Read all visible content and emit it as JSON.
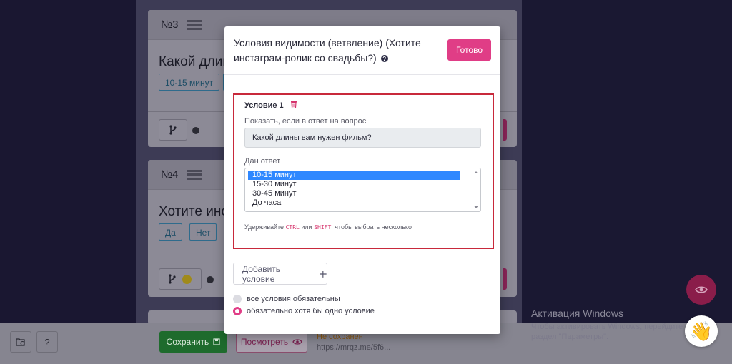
{
  "page": {
    "card3": {
      "number": "№3",
      "question": "Какой длин",
      "chips": [
        "10-15 минут"
      ]
    },
    "card4": {
      "number": "№4",
      "question": "Хотите инс",
      "chips": [
        "Да",
        "Нет"
      ]
    },
    "bottom": {
      "save_label": "Сохранить",
      "preview_label": "Посмотреть",
      "status": "Не сохранен",
      "short_url": "https://mrqz.me/5f6..."
    },
    "windows_activation": {
      "title": "Активация Windows",
      "line1": "Чтобы активировать Windows, перейдите",
      "line2": "раздел \"Параметры\"."
    }
  },
  "modal": {
    "title": "Условия видимости (ветвление) (Хотите инстаграм-ролик со свадьбы?)",
    "done_label": "Готово",
    "condition": {
      "title": "Условие 1",
      "show_if_label": "Показать, если в ответ на вопрос",
      "question_value": "Какой длины вам нужен фильм?",
      "answer_label": "Дан ответ",
      "options": [
        "10-15 минут",
        "15-30 минут",
        "30-45 минут",
        "До часа"
      ],
      "selected_option": "10-15 минут",
      "hint_prefix": "Удерживайте",
      "hint_key1": "CTRL",
      "hint_or": "или",
      "hint_key2": "SHIFT",
      "hint_suffix": ", чтобы выбрать несколько"
    },
    "add_condition_label": "Добавить условие",
    "radios": [
      {
        "label": "все условия обязательны",
        "checked": false
      },
      {
        "label": "обязательно хотя бы одно условие",
        "checked": true
      }
    ]
  },
  "colors": {
    "accent": "#e03d86",
    "condition_border": "#c8293b",
    "selected_option": "#2f88ff",
    "save_green": "#1e6b2d"
  },
  "icons": [
    "drag-lines-icon",
    "branch-icon",
    "info-icon",
    "help-icon",
    "trash-icon",
    "plus-icon",
    "eye-icon",
    "hand-wave-icon",
    "folder-clock-icon",
    "question-icon",
    "save-disk-icon"
  ]
}
